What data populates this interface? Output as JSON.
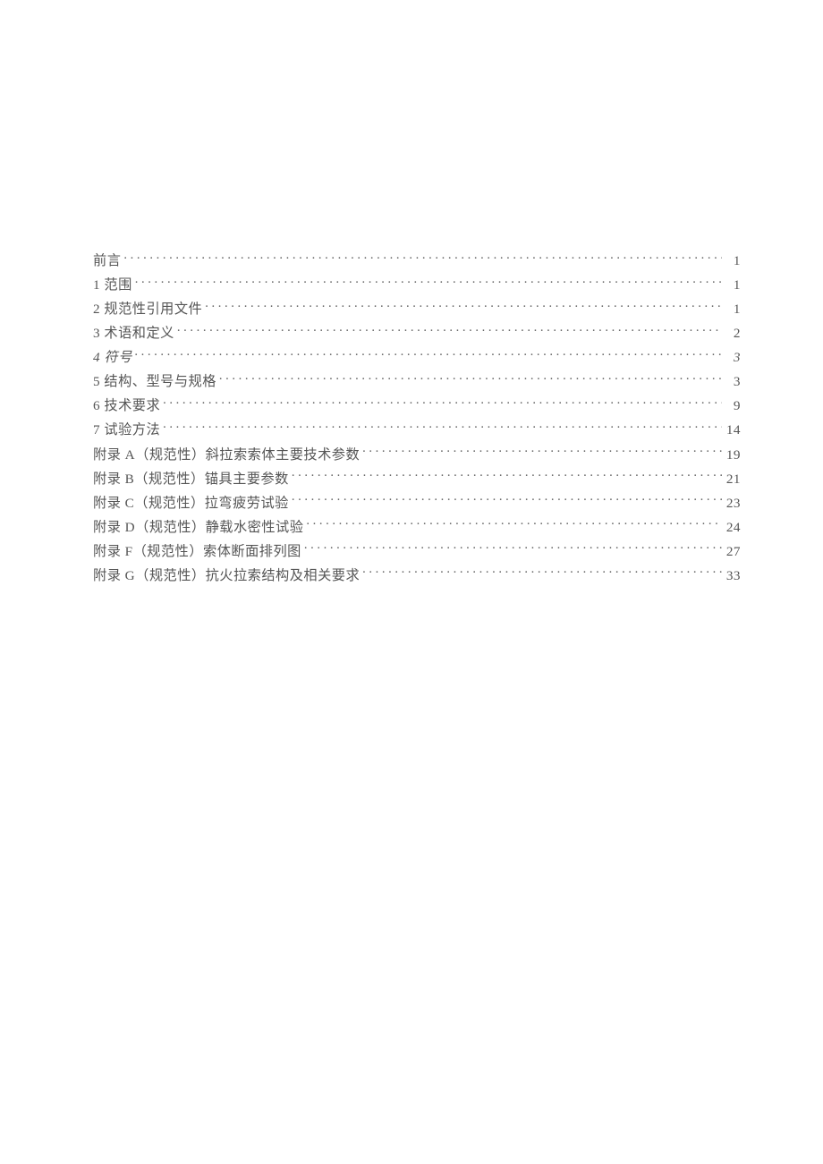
{
  "toc": {
    "entries": [
      {
        "title": "前言",
        "page": "1",
        "italic": false
      },
      {
        "title": "1 范围",
        "page": "1",
        "italic": false
      },
      {
        "title": "2 规范性引用文件",
        "page": "1",
        "italic": false
      },
      {
        "title": "3 术语和定义",
        "page": "2",
        "italic": false
      },
      {
        "title": "4 符号",
        "page": "3",
        "italic": true
      },
      {
        "title": "5 结构、型号与规格",
        "page": "3",
        "italic": false
      },
      {
        "title": "6 技术要求",
        "page": "9",
        "italic": false
      },
      {
        "title": "7 试验方法",
        "page": "14",
        "italic": false
      },
      {
        "title": "附录 A（规范性）斜拉索索体主要技术参数",
        "page": "19",
        "italic": false
      },
      {
        "title": "附录 B（规范性）锚具主要参数",
        "page": "21",
        "italic": false
      },
      {
        "title": "附录 C（规范性）拉弯疲劳试验",
        "page": "23",
        "italic": false
      },
      {
        "title": "附录 D（规范性）静载水密性试验",
        "page": "24",
        "italic": false
      },
      {
        "title": "附录 F（规范性）索体断面排列图",
        "page": "27",
        "italic": false
      },
      {
        "title": "附录 G（规范性）抗火拉索结构及相关要求",
        "page": "33",
        "italic": false
      }
    ]
  }
}
